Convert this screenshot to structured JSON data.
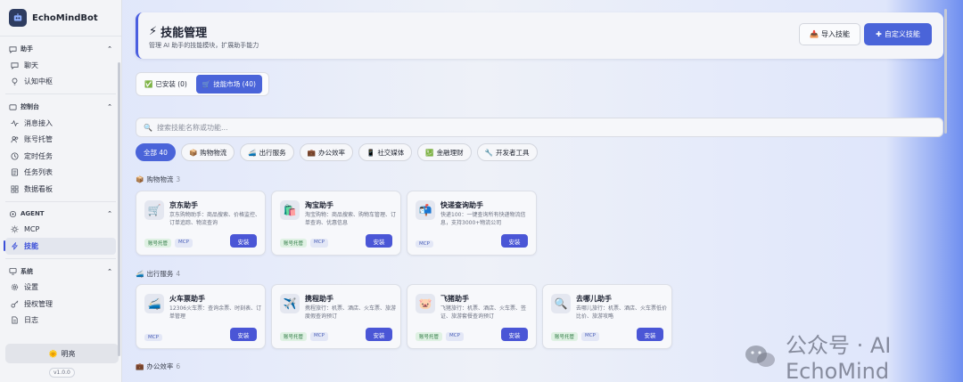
{
  "app": {
    "name": "EchoMindBot",
    "version": "v1.0.0"
  },
  "sidebar": {
    "groups": [
      {
        "label": "助手",
        "items": [
          {
            "label": "聊天",
            "icon": "chat-icon"
          },
          {
            "label": "认知中枢",
            "icon": "bulb-icon"
          }
        ]
      },
      {
        "label": "控制台",
        "items": [
          {
            "label": "消息接入",
            "icon": "pulse-icon"
          },
          {
            "label": "账号托管",
            "icon": "users-icon"
          },
          {
            "label": "定时任务",
            "icon": "clock-icon"
          },
          {
            "label": "任务列表",
            "icon": "list-icon"
          },
          {
            "label": "数据看板",
            "icon": "grid-icon"
          }
        ]
      },
      {
        "label": "AGENT",
        "items": [
          {
            "label": "MCP",
            "icon": "sun-icon"
          },
          {
            "label": "技能",
            "icon": "bolt-icon",
            "active": true
          }
        ]
      },
      {
        "label": "系统",
        "items": [
          {
            "label": "设置",
            "icon": "gear-icon"
          },
          {
            "label": "授权管理",
            "icon": "key-icon"
          },
          {
            "label": "日志",
            "icon": "doc-icon"
          }
        ]
      }
    ],
    "theme_label": "明亮"
  },
  "header": {
    "title": "技能管理",
    "subtitle": "管理 AI 助手的技能模块，扩展助手能力",
    "import_label": "导入技能",
    "custom_label": "自定义技能"
  },
  "tabs": [
    {
      "label": "已安装 (0)"
    },
    {
      "label": "技能市场 (40)",
      "active": true
    }
  ],
  "search": {
    "placeholder": "搜索技能名称或功能..."
  },
  "chips": [
    {
      "label": "全部 40",
      "active": true
    },
    {
      "label": "购物物流",
      "emoji": "📦"
    },
    {
      "label": "出行服务",
      "emoji": "🚄"
    },
    {
      "label": "办公效率",
      "emoji": "💼"
    },
    {
      "label": "社交媒体",
      "emoji": "📱"
    },
    {
      "label": "金融理财",
      "emoji": "💹"
    },
    {
      "label": "开发者工具",
      "emoji": "🔧"
    }
  ],
  "sections": [
    {
      "title": "购物物流",
      "emoji": "📦",
      "count": "3",
      "cards": [
        {
          "name": "京东助手",
          "emoji": "🛒",
          "desc": "京东购物助手：商品搜索、价格监控、订单追踪、物流查询",
          "tags": [
            "账号托管",
            "MCP"
          ],
          "install": "安装"
        },
        {
          "name": "淘宝助手",
          "emoji": "🛍️",
          "desc": "淘宝购物：商品搜索、购物车管理、订单查询、优惠信息",
          "tags": [
            "账号托管",
            "MCP"
          ],
          "install": "安装"
        },
        {
          "name": "快递查询助手",
          "emoji": "📬",
          "desc": "快递100：一键查询所有快递物流信息，支持3000+物流公司",
          "tags": [
            "MCP"
          ],
          "install": "安装"
        }
      ]
    },
    {
      "title": "出行服务",
      "emoji": "🚄",
      "count": "4",
      "cards": [
        {
          "name": "火车票助手",
          "emoji": "🚄",
          "desc": "12306火车票：查询余票、时刻表、订单管理",
          "tags": [
            "MCP"
          ],
          "install": "安装"
        },
        {
          "name": "携程助手",
          "emoji": "✈️",
          "desc": "携程旅行：机票、酒店、火车票、旅游度假查询预订",
          "tags": [
            "账号托管",
            "MCP"
          ],
          "install": "安装"
        },
        {
          "name": "飞猪助手",
          "emoji": "🐷",
          "desc": "飞猪旅行：机票、酒店、火车票、签证、旅游套餐查询预订",
          "tags": [
            "账号托管",
            "MCP"
          ],
          "install": "安装"
        },
        {
          "name": "去哪儿助手",
          "emoji": "🔍",
          "desc": "去哪儿旅行：机票、酒店、火车票低价比价、旅游攻略",
          "tags": [
            "账号托管",
            "MCP"
          ],
          "install": "安装"
        }
      ]
    },
    {
      "title": "办公效率",
      "emoji": "💼",
      "count": "6"
    }
  ],
  "watermark": "公众号 · AI EchoMind"
}
